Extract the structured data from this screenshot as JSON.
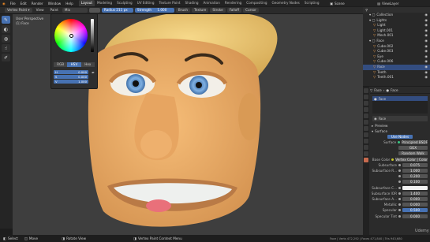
{
  "menus": [
    "File",
    "Edit",
    "Render",
    "Window",
    "Help"
  ],
  "workspaces": [
    "Layout",
    "Modeling",
    "Sculpting",
    "UV Editing",
    "Texture Paint",
    "Shading",
    "Animation",
    "Rendering",
    "Compositing",
    "Geometry Nodes",
    "Scripting"
  ],
  "active_workspace": "Layout",
  "scene": "Scene",
  "view_layer": "ViewLayer",
  "header": {
    "mode": "Vertex Paint",
    "view": "View",
    "paint": "Paint",
    "brush_name": "Mix",
    "radius_label": "Radius",
    "radius_value": "211 px",
    "strength_label": "Strength",
    "strength_value": "1.000",
    "brush": "Brush",
    "texture": "Texture",
    "stroke": "Stroke",
    "falloff": "Falloff",
    "cursor": "Cursor"
  },
  "viewport": {
    "perspective": "User Perspective",
    "object": "(1) Face"
  },
  "color_picker": {
    "modes": [
      "RGB",
      "HSV",
      "Hex"
    ],
    "active_mode": "HSV",
    "fields": [
      {
        "label": "H",
        "value": "0.000"
      },
      {
        "label": "S",
        "value": "0.000"
      },
      {
        "label": "V",
        "value": "1.000"
      }
    ]
  },
  "outliner": {
    "rows": [
      {
        "name": "Collection",
        "indent": 1,
        "selected": false
      },
      {
        "name": "Lights",
        "indent": 1,
        "selected": false
      },
      {
        "name": "Light",
        "indent": 2,
        "selected": false
      },
      {
        "name": "Light.001",
        "indent": 2,
        "selected": false
      },
      {
        "name": "Mesh.001",
        "indent": 2,
        "selected": false
      },
      {
        "name": "Face",
        "indent": 1,
        "selected": false
      },
      {
        "name": "Cube.002",
        "indent": 2,
        "selected": false
      },
      {
        "name": "Cube.003",
        "indent": 2,
        "selected": false
      },
      {
        "name": "Eye",
        "indent": 2,
        "selected": false
      },
      {
        "name": "Cube.006",
        "indent": 2,
        "selected": false
      },
      {
        "name": "Face",
        "indent": 2,
        "selected": true
      },
      {
        "name": "Teeth",
        "indent": 2,
        "selected": false
      },
      {
        "name": "Teeth.001",
        "indent": 2,
        "selected": false
      }
    ]
  },
  "properties": {
    "object_name": "Face",
    "material_name": "Face",
    "material_slot": "Face",
    "sections": {
      "preview": "Preview",
      "surface": "Surface"
    },
    "use_nodes": "Use Nodes",
    "surface_shader": "Principled BSDF",
    "distribution": "GGX",
    "subsurface_method": "Random Walk",
    "base_color_source": "Vertex Color | Color",
    "fields": [
      {
        "label": "Subsurface",
        "value": "0.075"
      },
      {
        "label": "Subsurface R...",
        "value": "1.000"
      },
      {
        "label": "",
        "value": "0.200"
      },
      {
        "label": "",
        "value": "0.100"
      },
      {
        "label": "Subsurface C...",
        "value": ""
      },
      {
        "label": "Subsurface IOR",
        "value": "1.400"
      },
      {
        "label": "Subsurface A...",
        "value": "0.000"
      },
      {
        "label": "Metallic",
        "value": "0.000"
      },
      {
        "label": "Specular",
        "value": "0.500"
      },
      {
        "label": "Specular Tint",
        "value": "0.000"
      }
    ],
    "labels": {
      "surface": "Surface",
      "base_color": "Base Color",
      "distribution": "",
      "method": ""
    }
  },
  "status": {
    "select": "Select",
    "move": "Move",
    "rotate": "Rotate View",
    "context": "Vertex Paint Context Menu",
    "stats": "Face | Verts 472,292 | Faces 471,840 | Tris 943,680",
    "watermark": "Udemy"
  },
  "colors": {
    "accent": "#4772b3",
    "skin": "#e8a862",
    "hair": "#f0c874",
    "iris": "#7fb0e2"
  }
}
